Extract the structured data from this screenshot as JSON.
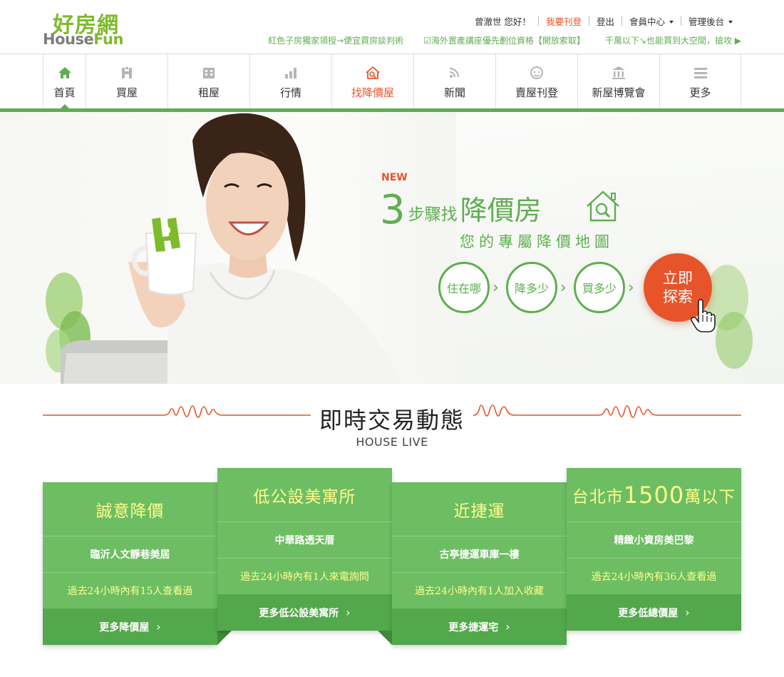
{
  "logo": {
    "cn": "好房網",
    "en_part1": "House",
    "en_part2": "Fun"
  },
  "user_bar": {
    "greeting": "曾澈世 您好！",
    "post_listing": "我要刊登",
    "logout": "登出",
    "member_center": "會員中心",
    "admin": "管理後台"
  },
  "promos": [
    "紅色子房獨家領授→便宜買房談判術",
    "☑海外置產講座優先劃位資格【開放索取】",
    "千萬以下↘也能買到大空間，搶攻 ▶"
  ],
  "nav": [
    {
      "label": "首頁",
      "icon": "home-icon"
    },
    {
      "label": "買屋",
      "icon": "buy-house-icon"
    },
    {
      "label": "租屋",
      "icon": "building-icon"
    },
    {
      "label": "行情",
      "icon": "bar-chart-icon"
    },
    {
      "label": "找降價屋",
      "icon": "house-search-icon"
    },
    {
      "label": "新聞",
      "icon": "rss-icon"
    },
    {
      "label": "賣屋刊登",
      "icon": "agent-icon"
    },
    {
      "label": "新屋博覽會",
      "icon": "bank-building-icon"
    },
    {
      "label": "更多",
      "icon": "menu-icon"
    }
  ],
  "hero": {
    "new_badge": "NEW",
    "title_num": "3",
    "title_small": "步驟找",
    "title_big": "降價房",
    "subtitle": "您的專屬降價地圖",
    "steps": [
      "住在哪",
      "降多少",
      "買多少"
    ],
    "cta_line1": "立即",
    "cta_line2": "探索"
  },
  "live": {
    "title": "即時交易動態",
    "subtitle": "HOUSE LIVE"
  },
  "cards": [
    {
      "title": "誠意降價",
      "item": "臨沂人文靜巷美居",
      "stat": "過去24小時內有15人查看過",
      "more": "更多降價屋"
    },
    {
      "title": "低公設美寓所",
      "item": "中華路透天厝",
      "stat": "過去24小時內有1人來電詢問",
      "more": "更多低公設美寓所"
    },
    {
      "title": "近捷運",
      "item": "古亭捷運車庫一樓",
      "stat": "過去24小時內有1人加入收藏",
      "more": "更多捷運宅"
    },
    {
      "title_prefix": "台北市",
      "title_num": "1500",
      "title_suffix": "萬以下",
      "item": "精緻小資房美巴黎",
      "stat": "過去24小時內有36人查看過",
      "more": "更多低總價屋"
    }
  ],
  "colors": {
    "brand_green": "#5fae50",
    "card_green": "#6dbd63",
    "accent_orange": "#e8542a",
    "card_yellow": "#fffd8c"
  }
}
